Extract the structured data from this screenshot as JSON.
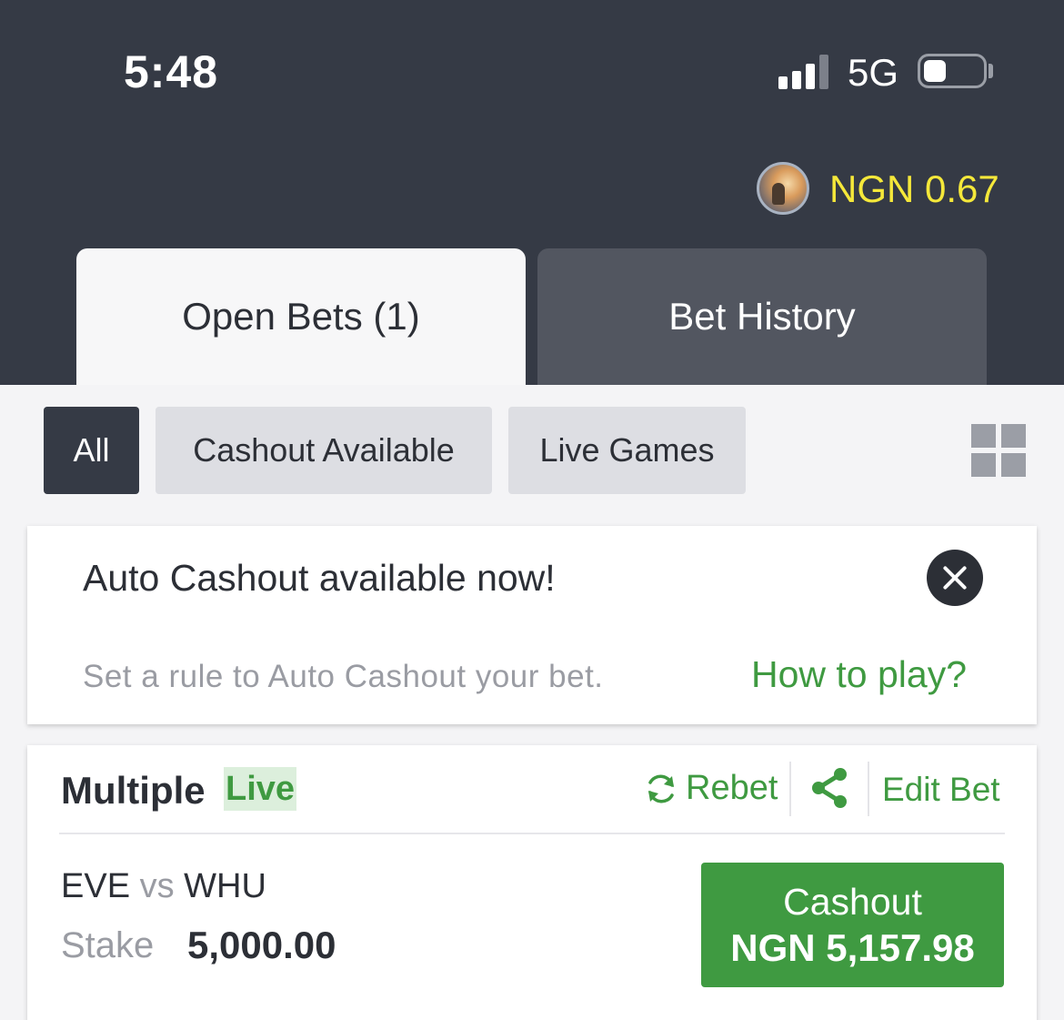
{
  "status_bar": {
    "time": "5:48",
    "network": "5G"
  },
  "header": {
    "balance": "NGN 0.67",
    "tabs": [
      {
        "label": "Open Bets (1)",
        "active": true
      },
      {
        "label": "Bet History",
        "active": false
      }
    ]
  },
  "filters": [
    {
      "label": "All",
      "active": true
    },
    {
      "label": "Cashout Available",
      "active": false
    },
    {
      "label": "Live Games",
      "active": false
    }
  ],
  "promo": {
    "title": "Auto Cashout available now!",
    "description": "Set a rule to Auto Cashout your bet.",
    "link": "How to play?"
  },
  "bet": {
    "type": "Multiple",
    "badge": "Live",
    "rebet_label": "Rebet",
    "edit_label": "Edit Bet",
    "home": "EVE",
    "vs": "vs",
    "away": "WHU",
    "stake_label": "Stake",
    "stake_value": "5,000.00",
    "cashout_label": "Cashout",
    "cashout_amount": "NGN 5,157.98"
  },
  "colors": {
    "header_bg": "#353a45",
    "accent_green": "#3f9a41",
    "balance_yellow": "#f5e83a"
  }
}
